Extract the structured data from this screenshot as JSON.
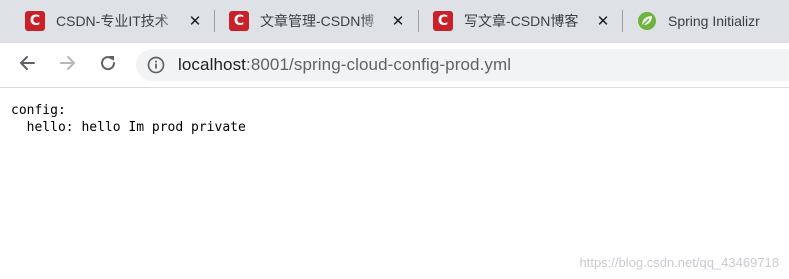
{
  "tabs": [
    {
      "title": "CSDN-专业IT技术",
      "favicon": "csdn-icon",
      "close": "✕"
    },
    {
      "title": "文章管理-CSDN博",
      "favicon": "csdn-icon",
      "close": "✕"
    },
    {
      "title": "写文章-CSDN博客",
      "favicon": "csdn-icon",
      "close": "✕"
    },
    {
      "title": "Spring Initializr",
      "favicon": "spring-leaf-icon"
    }
  ],
  "favicon_letter": "C",
  "colors": {
    "csdn_red": "#c9202a",
    "spring_green": "#6db33f",
    "tabstrip": "#dee1e6"
  },
  "address_bar": {
    "host": "localhost",
    "path": ":8001/spring-cloud-config-prod.yml"
  },
  "page": {
    "line1": "config:",
    "line2": "  hello: hello Im prod private"
  },
  "watermark": "https://blog.csdn.net/qq_43469718"
}
